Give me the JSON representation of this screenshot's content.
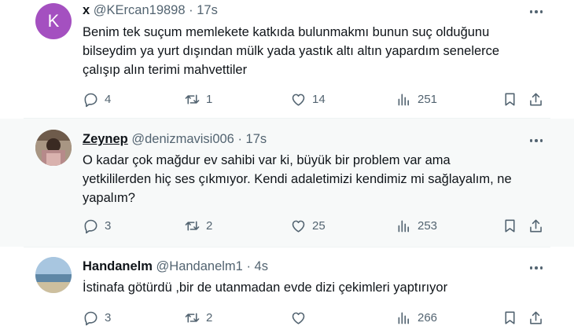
{
  "tweets": [
    {
      "avatar_letter": "K",
      "name": "x",
      "handle": "@KErcan19898",
      "dot": "·",
      "time": "17s",
      "text_lines": [
        "Benim tek suçum memlekete katkıda bulunmakmı bunun suç olduğunu",
        "bilseydim ya yurt dışından mülk yada yastık altı altın yapardım senelerce",
        "çalışıp alın terimi mahvettiler"
      ],
      "replies": "4",
      "retweets": "1",
      "likes": "14",
      "views": "251"
    },
    {
      "name": "Zeynep",
      "handle": "@denizmavisi006",
      "dot": "·",
      "time": "17s",
      "text_lines": [
        "O kadar çok mağdur ev sahibi var ki, büyük bir problem var ama",
        "yetkililerden hiç ses çıkmıyor. Kendi adaletimizi kendimiz mi sağlayalım, ne",
        "yapalım?"
      ],
      "replies": "3",
      "retweets": "2",
      "likes": "25",
      "views": "253"
    },
    {
      "name": "Handanelm",
      "handle": "@Handanelm1",
      "dot": "·",
      "time": "4s",
      "text_lines": [
        "İstinafa götürdü ,bir de utanmadan evde dizi çekimleri yaptırıyor"
      ],
      "replies": "3",
      "retweets": "2",
      "likes": "",
      "views": "266"
    }
  ],
  "icons": [
    "reply-icon",
    "retweet-icon",
    "like-icon",
    "views-icon",
    "bookmark-icon",
    "share-icon",
    "more-icon"
  ],
  "colors": {
    "text": "#0f1419",
    "secondary": "#536471",
    "avatar_k": "#a450c0",
    "highlight_bg": "#f7f9f9"
  }
}
